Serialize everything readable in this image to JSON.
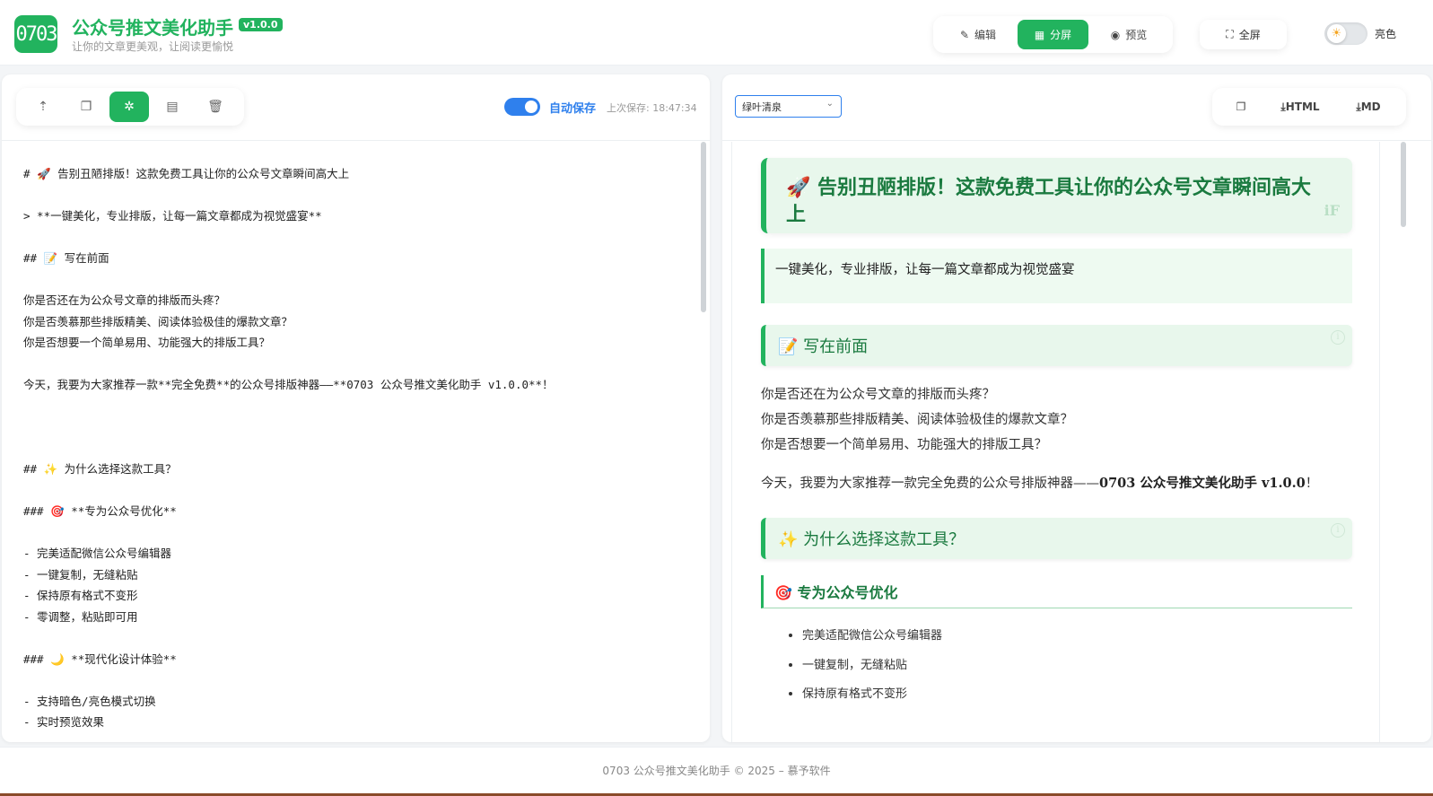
{
  "app": {
    "logo_text": "0703",
    "title": "公众号推文美化助手",
    "version": "v1.0.0",
    "subtitle": "让你的文章更美观，让阅读更愉悦"
  },
  "view_modes": [
    {
      "label": "编辑",
      "icon": "edit-icon",
      "active": false
    },
    {
      "label": "分屏",
      "icon": "grid-icon",
      "active": true
    },
    {
      "label": "预览",
      "icon": "eye-icon",
      "active": false
    }
  ],
  "fullscreen_label": "全屏",
  "theme_mode_label": "亮色",
  "editor_toolbar": {
    "tools": [
      "upload-icon",
      "copy-icon",
      "magic-format-icon",
      "document-icon",
      "trash-icon"
    ],
    "active_tool": 2,
    "autosave_label": "自动保存",
    "last_saved": "上次保存: 18:47:34",
    "autosave_on": true
  },
  "editor_lines": [
    "# 🚀 告别丑陋排版！这款免费工具让你的公众号文章瞬间高大上",
    "",
    "> **一键美化，专业排版，让每一篇文章都成为视觉盛宴**",
    "",
    "## 📝 写在前面",
    "",
    "你是否还在为公众号文章的排版而头疼？",
    "你是否羡慕那些排版精美、阅读体验极佳的爆款文章？",
    "你是否想要一个简单易用、功能强大的排版工具？",
    "",
    "今天，我要为大家推荐一款**完全免费**的公众号排版神器——**0703 公众号推文美化助手 v1.0.0**！",
    "",
    "",
    "",
    "## ✨ 为什么选择这款工具？",
    "",
    "### 🎯 **专为公众号优化**",
    "",
    "- 完美适配微信公众号编辑器",
    "- 一键复制，无缝粘贴",
    "- 保持原有格式不变形",
    "- 零调整，粘贴即可用",
    "",
    "### 🌙 **现代化设计体验**",
    "",
    "- 支持暗色/亮色模式切换",
    "- 实时预览效果"
  ],
  "preview_toolbar": {
    "theme_select": "绿叶清泉",
    "export_html": "HTML",
    "export_md": "MD"
  },
  "preview": {
    "h1": "🚀 告别丑陋排版！这款免费工具让你的公众号文章瞬间高大上",
    "h1_deco": "iF",
    "quote": "一键美化，专业排版，让每一篇文章都成为视觉盛宴",
    "h2_intro": "📝 写在前面",
    "intro_lines": [
      "你是否还在为公众号文章的排版而头疼？",
      "你是否羡慕那些排版精美、阅读体验极佳的爆款文章？",
      "你是否想要一个简单易用、功能强大的排版工具？"
    ],
    "recommend_prefix": "今天，我要为大家推荐一款完全免费的公众号排版神器——",
    "recommend_bold": "0703 公众号推文美化助手 v1.0.0",
    "recommend_suffix": "！",
    "h2_why": "✨ 为什么选择这款工具？",
    "h3_optimize": "🎯 专为公众号优化",
    "optimize_items": [
      "完美适配微信公众号编辑器",
      "一键复制，无缝粘贴",
      "保持原有格式不变形"
    ]
  },
  "footer": "0703 公众号推文美化助手 © 2025 – 慕予软件",
  "colors": {
    "accent": "#22b35e",
    "link_blue": "#2f80ed",
    "preview_heading": "#1a7a3f",
    "preview_bg": "#e8f7ec"
  }
}
